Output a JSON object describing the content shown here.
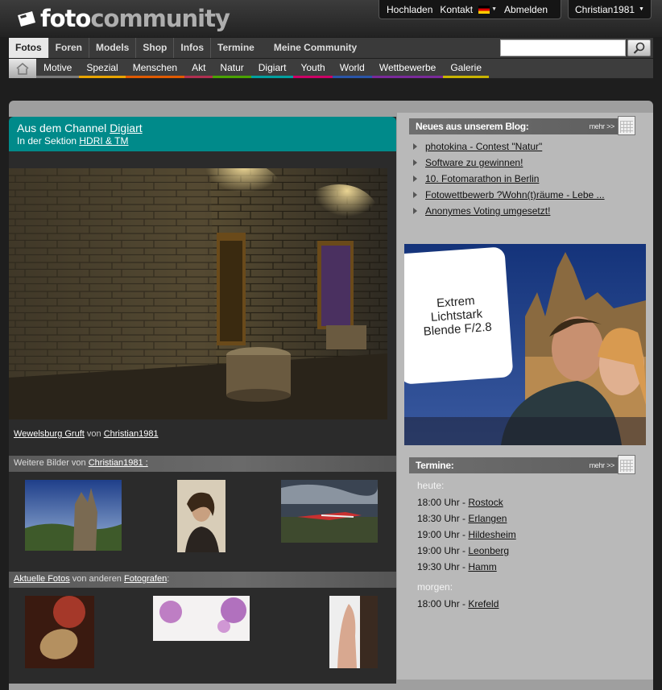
{
  "brand": {
    "name_part1": "foto",
    "name_part2": "community"
  },
  "toplinks": {
    "upload": "Hochladen",
    "contact": "Kontakt",
    "logout": "Abmelden"
  },
  "user": {
    "name": "Christian1981"
  },
  "mainnav": [
    "Fotos",
    "Foren",
    "Models",
    "Shop",
    "Infos",
    "Termine",
    "Meine Community"
  ],
  "search": {
    "placeholder": ""
  },
  "subnav": [
    {
      "label": "Motive",
      "color": "#7a7a7a"
    },
    {
      "label": "Spezial",
      "color": "#e8a400"
    },
    {
      "label": "Menschen",
      "color": "#e05a00"
    },
    {
      "label": "Akt",
      "color": "#b03050"
    },
    {
      "label": "Natur",
      "color": "#4aa300"
    },
    {
      "label": "Digiart",
      "color": "#00a0a0"
    },
    {
      "label": "Youth",
      "color": "#cc0066"
    },
    {
      "label": "World",
      "color": "#2a55a8"
    },
    {
      "label": "Wettbewerbe",
      "color": "#7a2a9a"
    },
    {
      "label": "Galerie",
      "color": "#c8b400"
    }
  ],
  "channel": {
    "prefix": "Aus dem Channel",
    "name": "Digiart",
    "section_prefix": "In der Sektion",
    "section": "HDRI & TM"
  },
  "photo": {
    "title": "Wewelsburg Gruft",
    "by": "von",
    "author": "Christian1981"
  },
  "more_by": {
    "prefix": "Weitere Bilder von",
    "author": "Christian1981 :"
  },
  "current": {
    "link": "Aktuelle Fotos",
    "middle": "von anderen",
    "link2": "Fotografen",
    "suffix": ":"
  },
  "blog": {
    "title": "Neues aus unserem Blog:",
    "more": "mehr >>",
    "items": [
      "photokina - Contest \"Natur\"",
      "Software zu gewinnen!",
      "10. Fotomarathon in Berlin",
      "Fotowettbewerb ?Wohn(t)räume - Lebe ...",
      "Anonymes Voting umgesetzt!"
    ]
  },
  "ad": {
    "line1": "Extrem",
    "line2": "Lichtstark",
    "line3": "Blende F/2.8"
  },
  "termine": {
    "title": "Termine:",
    "more": "mehr >>",
    "today_label": "heute:",
    "today": [
      {
        "time": "18:00 Uhr - ",
        "city": "Rostock"
      },
      {
        "time": "18:30 Uhr - ",
        "city": "Erlangen"
      },
      {
        "time": "19:00 Uhr - ",
        "city": "Hildesheim"
      },
      {
        "time": "19:00 Uhr - ",
        "city": "Leonberg"
      },
      {
        "time": "19:30 Uhr - ",
        "city": "Hamm"
      }
    ],
    "tomorrow_label": "morgen:",
    "tomorrow": [
      {
        "time": "18:00 Uhr - ",
        "city": "Krefeld"
      }
    ]
  }
}
